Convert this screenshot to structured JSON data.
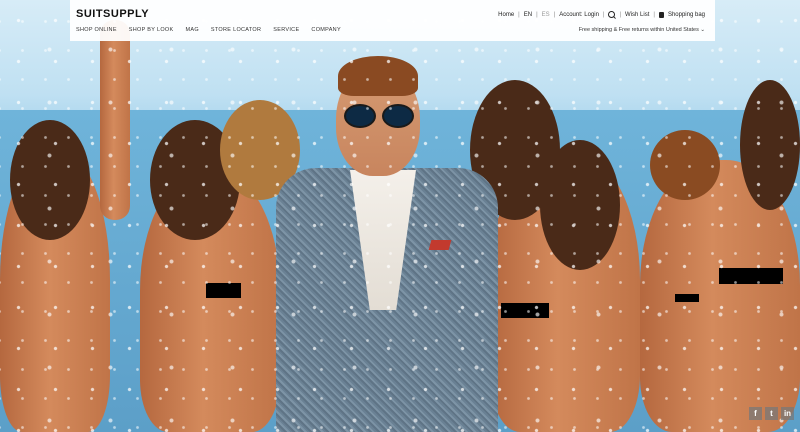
{
  "brand": {
    "logo_text": "SUITSUPPLY"
  },
  "nav": {
    "items": [
      "SHOP ONLINE",
      "SHOP BY LOOK",
      "MAG",
      "STORE LOCATOR",
      "SERVICE",
      "COMPANY"
    ]
  },
  "utility": {
    "home": "Home",
    "lang_en": "EN",
    "lang_es": "ES",
    "account": "Account: Login",
    "wishlist": "Wish List",
    "bag": "Shopping bag",
    "separator": "|"
  },
  "promo": {
    "shipping": "Free shipping & Free returns within United States"
  },
  "social": {
    "facebook": "f",
    "twitter": "t",
    "linkedin": "in"
  },
  "icons": [
    "search-icon",
    "shopping-bag-icon",
    "facebook-icon",
    "twitter-icon",
    "linkedin-icon"
  ]
}
